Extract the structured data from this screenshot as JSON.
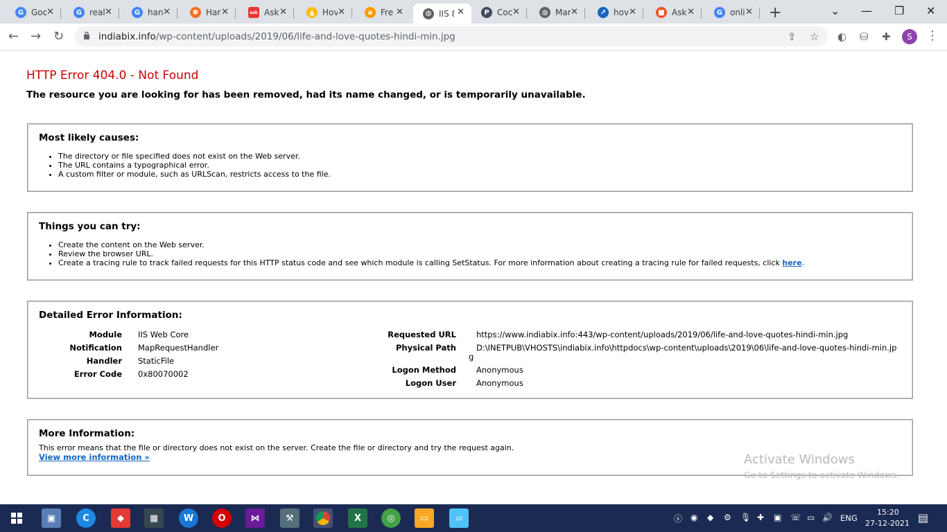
{
  "browser": {
    "tabs": [
      {
        "title": "Goo",
        "favicon": "google-icon",
        "color": "#4285f4",
        "glyph": "G"
      },
      {
        "title": "real",
        "favicon": "google-icon",
        "color": "#4285f4",
        "glyph": "G"
      },
      {
        "title": "han",
        "favicon": "google-icon",
        "color": "#4285f4",
        "glyph": "G"
      },
      {
        "title": "Har",
        "favicon": "hatke-icon",
        "color": "#f37021",
        "glyph": "✽"
      },
      {
        "title": "Ask",
        "favicon": "askme-icon",
        "color": "#e53935",
        "glyph": "ask"
      },
      {
        "title": "Hov",
        "favicon": "google-ads-icon",
        "color": "#fbbc04",
        "glyph": "▲"
      },
      {
        "title": "Fre",
        "favicon": "amazon-icon",
        "color": "#ff9900",
        "glyph": "a"
      },
      {
        "title": "IIS 8",
        "favicon": "globe-icon",
        "color": "#5f6368",
        "glyph": "◍"
      },
      {
        "title": "Coc",
        "favicon": "pocket-icon",
        "color": "#3d4b5c",
        "glyph": "P"
      },
      {
        "title": "Mar",
        "favicon": "globe-icon",
        "color": "#5f6368",
        "glyph": "◍"
      },
      {
        "title": "hov",
        "favicon": "docs-icon",
        "color": "#1565c0",
        "glyph": "↗"
      },
      {
        "title": "Ask",
        "favicon": "microsoft-icon",
        "color": "#f25022",
        "glyph": "■"
      },
      {
        "title": "onli",
        "favicon": "google-icon",
        "color": "#4285f4",
        "glyph": "G"
      }
    ],
    "url_host": "indiabix.info",
    "url_path": "/wp-content/uploads/2019/06/life-and-love-quotes-hindi-min.jpg",
    "profile_initial": "S"
  },
  "error": {
    "title": "HTTP Error 404.0 - Not Found",
    "subtitle": "The resource you are looking for has been removed, had its name changed, or is temporarily unavailable."
  },
  "causes": {
    "heading": "Most likely causes:",
    "items": [
      "The directory or file specified does not exist on the Web server.",
      "The URL contains a typographical error.",
      "A custom filter or module, such as URLScan, restricts access to the file."
    ]
  },
  "try": {
    "heading": "Things you can try:",
    "item1": "Create the content on the Web server.",
    "item2": "Review the browser URL.",
    "item3": "Create a tracing rule to track failed requests for this HTTP status code and see which module is calling SetStatus. For more information about creating a tracing rule for failed requests, click ",
    "item3_link": "here",
    "item3_end": "."
  },
  "details": {
    "heading": "Detailed Error Information:",
    "left": [
      {
        "label": "Module",
        "value": "IIS Web Core"
      },
      {
        "label": "Notification",
        "value": "MapRequestHandler"
      },
      {
        "label": "Handler",
        "value": "StaticFile"
      },
      {
        "label": "Error Code",
        "value": "0x80070002"
      }
    ],
    "right": {
      "requested_url_label": "Requested URL",
      "requested_url": "https://www.indiabix.info:443/wp-content/uploads/2019/06/life-and-love-quotes-hindi-min.jpg",
      "physical_path_label": "Physical Path",
      "physical_path_1": "D:\\INETPUB\\VHOSTS\\indiabix.info\\httpdocs\\wp-content\\uploads\\2019\\06\\life-and-love-quotes-hindi-min.jp",
      "physical_path_2": "g",
      "logon_method_label": "Logon Method",
      "logon_method": "Anonymous",
      "logon_user_label": "Logon User",
      "logon_user": "Anonymous"
    }
  },
  "more": {
    "heading": "More Information:",
    "text": "This error means that the file or directory does not exist on the server. Create the file or directory and try the request again.",
    "link": "View more information »"
  },
  "watermark": {
    "title": "Activate Windows",
    "subtitle": "Go to Settings to activate Windows."
  },
  "taskbar": {
    "language": "ENG",
    "time": "15:20",
    "date": "27-12-2021"
  }
}
